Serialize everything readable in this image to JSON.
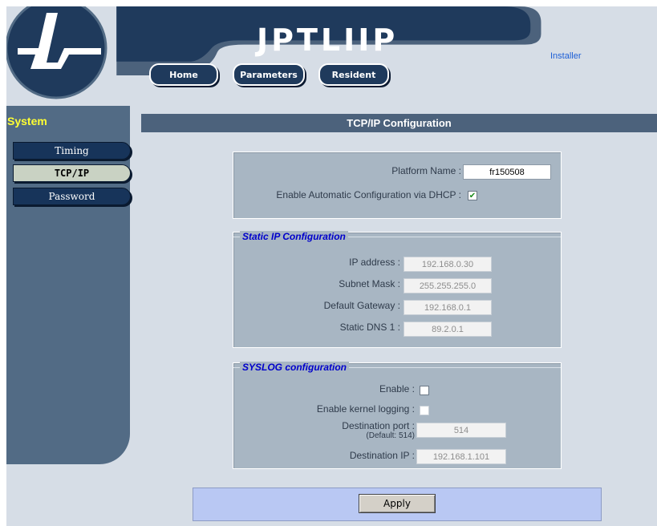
{
  "header": {
    "title": "JPTLIIP",
    "installer_link": "Installer",
    "nav": [
      "Home",
      "Parameters",
      "Resident"
    ]
  },
  "sidebar": {
    "title": "System",
    "items": [
      {
        "label": "Timing",
        "active": false
      },
      {
        "label": "TCP/IP",
        "active": true
      },
      {
        "label": "Password",
        "active": false
      }
    ]
  },
  "section_title": "TCP/IP Configuration",
  "platform": {
    "name_label": "Platform Name :",
    "name_value": "fr150508",
    "dhcp_label": "Enable Automatic Configuration via DHCP :",
    "dhcp_checked": true
  },
  "static_ip": {
    "legend": "Static IP Configuration",
    "ip_label": "IP address :",
    "ip_value": "192.168.0.30",
    "mask_label": "Subnet Mask :",
    "mask_value": "255.255.255.0",
    "gateway_label": "Default Gateway :",
    "gateway_value": "192.168.0.1",
    "dns_label": "Static DNS 1 :",
    "dns_value": "89.2.0.1"
  },
  "syslog": {
    "legend": "SYSLOG configuration",
    "enable_label": "Enable :",
    "kernel_label": "Enable kernel logging :",
    "port_label": "Destination port :",
    "port_hint": "(Default: 514)",
    "port_value": "514",
    "ip_label": "Destination IP :",
    "ip_value": "192.168.1.101"
  },
  "apply_label": "Apply",
  "colors": {
    "banner": "#1f3a5c",
    "sidebar": "#526b85",
    "section_bar": "#4c627c",
    "accent_yellow": "#ffff33",
    "legend_blue": "#0000cc"
  }
}
